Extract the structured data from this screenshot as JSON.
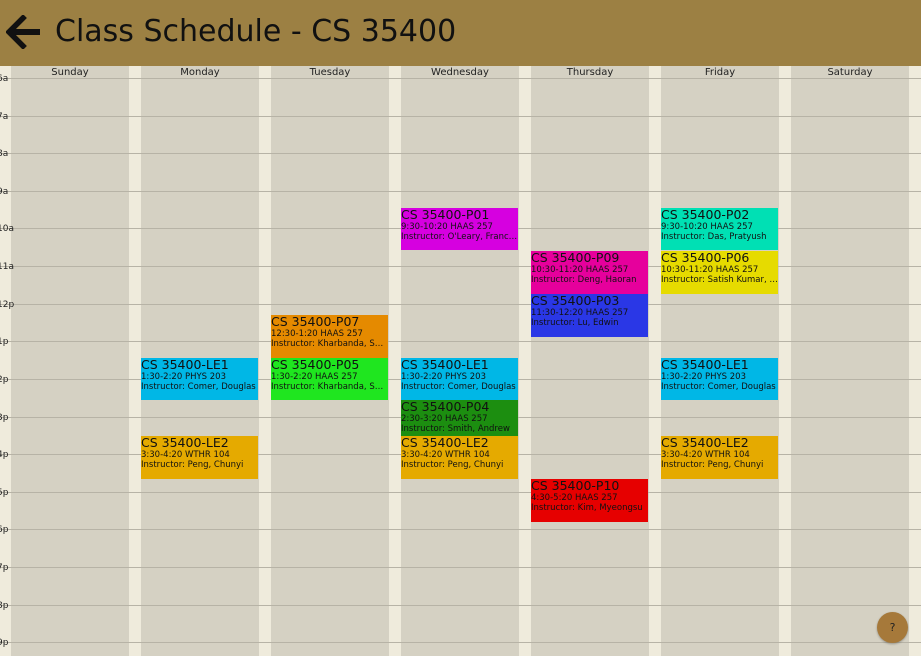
{
  "header": {
    "title": "Class Schedule - CS 35400",
    "back_icon": "arrow-left-icon"
  },
  "days": [
    "Sunday",
    "Monday",
    "Tuesday",
    "Wednesday",
    "Thursday",
    "Friday",
    "Saturday"
  ],
  "hours": [
    "6a",
    "7a",
    "8a",
    "9a",
    "10a",
    "11a",
    "12p",
    "1p",
    "2p",
    "3p",
    "4p",
    "5p",
    "6p",
    "7p",
    "8p",
    "9p"
  ],
  "events": [
    {
      "name": "CS 35400-LE1",
      "time": "1:30-2:20 PHYS 203",
      "instructor": "Instructor: Comer, Douglas",
      "color": "#00b7e6"
    },
    {
      "name": "CS 35400-LE2",
      "time": "3:30-4:20 WTHR 104",
      "instructor": "Instructor: Peng, Chunyi",
      "color": "#e5aa00"
    },
    {
      "name": "CS 35400-P07",
      "time": "12:30-1:20 HAAS 257",
      "instructor": "Instructor: Kharbanda, Sh…",
      "color": "#e58a00"
    },
    {
      "name": "CS 35400-P05",
      "time": "1:30-2:20 HAAS 257",
      "instructor": "Instructor: Kharbanda, Sh…",
      "color": "#1fe61f"
    },
    {
      "name": "CS 35400-P01",
      "time": "9:30-10:20 HAAS 257",
      "instructor": "Instructor: O'Leary, Frances",
      "color": "#d600e0"
    },
    {
      "name": "CS 35400-LE1",
      "time": "1:30-2:20 PHYS 203",
      "instructor": "Instructor: Comer, Douglas",
      "color": "#00b7e6"
    },
    {
      "name": "CS 35400-P04",
      "time": "2:30-3:20 HAAS 257",
      "instructor": "Instructor: Smith, Andrew",
      "color": "#1c8e10"
    },
    {
      "name": "CS 35400-LE2",
      "time": "3:30-4:20 WTHR 104",
      "instructor": "Instructor: Peng, Chunyi",
      "color": "#e5aa00"
    },
    {
      "name": "CS 35400-P09",
      "time": "10:30-11:20 HAAS 257",
      "instructor": "Instructor: Deng, Haoran",
      "color": "#e6009c"
    },
    {
      "name": "CS 35400-P03",
      "time": "11:30-12:20 HAAS 257",
      "instructor": "Instructor: Lu, Edwin",
      "color": "#2a37e6"
    },
    {
      "name": "CS 35400-P10",
      "time": "4:30-5:20 HAAS 257",
      "instructor": "Instructor: Kim, Myeongsu",
      "color": "#e60000"
    },
    {
      "name": "CS 35400-P02",
      "time": "9:30-10:20 HAAS 257",
      "instructor": "Instructor: Das, Pratyush",
      "color": "#00e0b4"
    },
    {
      "name": "CS 35400-P06",
      "time": "10:30-11:20 HAAS 257",
      "instructor": "Instructor: Satish Kumar, …",
      "color": "#e6db00"
    },
    {
      "name": "CS 35400-LE1",
      "time": "1:30-2:20 PHYS 203",
      "instructor": "Instructor: Comer, Douglas",
      "color": "#00b7e6"
    },
    {
      "name": "CS 35400-LE2",
      "time": "3:30-4:20 WTHR 104",
      "instructor": "Instructor: Peng, Chunyi",
      "color": "#e5aa00"
    }
  ],
  "help": {
    "label": "?",
    "icon": "help-icon"
  }
}
